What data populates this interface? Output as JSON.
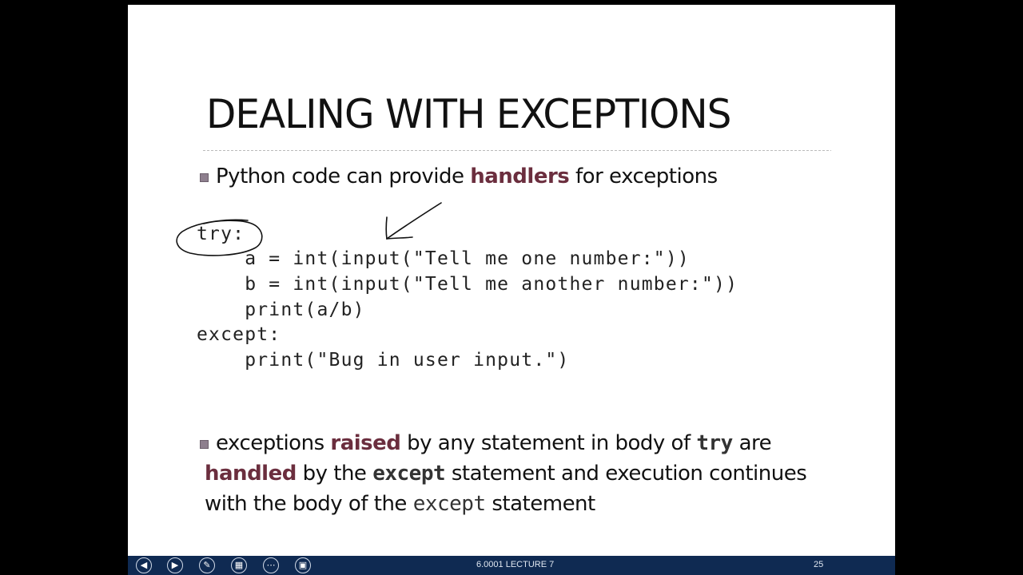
{
  "slide": {
    "title": "DEALING WITH EXCEPTIONS",
    "bullet1": {
      "pre": "Python code can provide ",
      "highlight": "handlers",
      "post": " for exceptions"
    },
    "code": [
      "try:",
      "    a = int(input(\"Tell me one number:\"))",
      "    b = int(input(\"Tell me another number:\"))",
      "    print(a/b)",
      "except:",
      "    print(\"Bug in user input.\")"
    ],
    "bullet2": {
      "line1_pre": "exceptions ",
      "line1_hl": "raised",
      "line1_mid": " by any statement in body of ",
      "line1_code": "try",
      "line1_post": " are",
      "line2_hl": "handled",
      "line2_mid": " by the ",
      "line2_code": "except",
      "line2_post": " statement and execution continues",
      "line3_pre": "with the body of the ",
      "line3_code": "except",
      "line3_post": " statement"
    }
  },
  "toolbar": {
    "buttons": [
      {
        "name": "previous-slide-button",
        "icon": "◀"
      },
      {
        "name": "next-slide-button",
        "icon": "▶"
      },
      {
        "name": "pen-tool-button",
        "icon": "✎"
      },
      {
        "name": "see-all-slides-button",
        "icon": "▦"
      },
      {
        "name": "more-options-button",
        "icon": "⋯"
      },
      {
        "name": "screen-display-button",
        "icon": "▣"
      }
    ],
    "footer_label": "6.0001 LECTURE 7",
    "slide_number": "25"
  },
  "colors": {
    "highlight": "#6b2e3e",
    "taskbar": "#0f2a52",
    "background": "#000000"
  }
}
